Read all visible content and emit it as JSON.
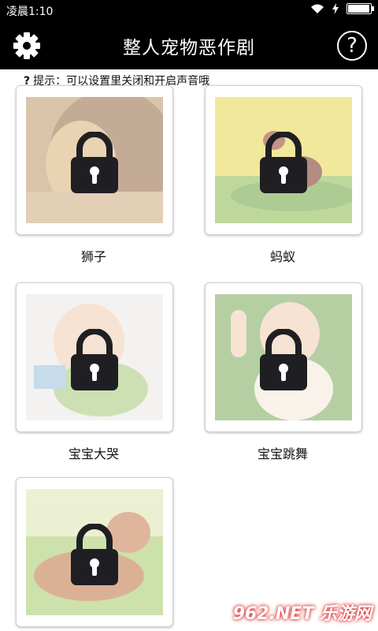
{
  "status_bar": {
    "time": "凌晨1:10",
    "battery_level": 0.95
  },
  "app_bar": {
    "title": "整人宠物恶作剧",
    "help_symbol": "?"
  },
  "hint": {
    "icon": "?",
    "text": "提示：可以设置里关闭和开启声音哦"
  },
  "cards": [
    {
      "label": "狮子",
      "icon": "lock-icon",
      "image": "lion-photo",
      "locked": true
    },
    {
      "label": "蚂蚁",
      "icon": "lock-icon",
      "image": "ant-photo",
      "locked": true
    },
    {
      "label": "宝宝大哭",
      "icon": "lock-icon",
      "image": "crying-baby-photo",
      "locked": true
    },
    {
      "label": "宝宝跳舞",
      "icon": "lock-icon",
      "image": "dancing-baby-photo",
      "locked": true
    },
    {
      "label": "",
      "icon": "lock-icon",
      "image": "dog-photo",
      "locked": true
    }
  ],
  "watermark": {
    "text": "962.NET 乐游网"
  },
  "colors": {
    "bar": "#000000",
    "lock": "#1f1f23",
    "card_border": "#cfcfcf"
  }
}
